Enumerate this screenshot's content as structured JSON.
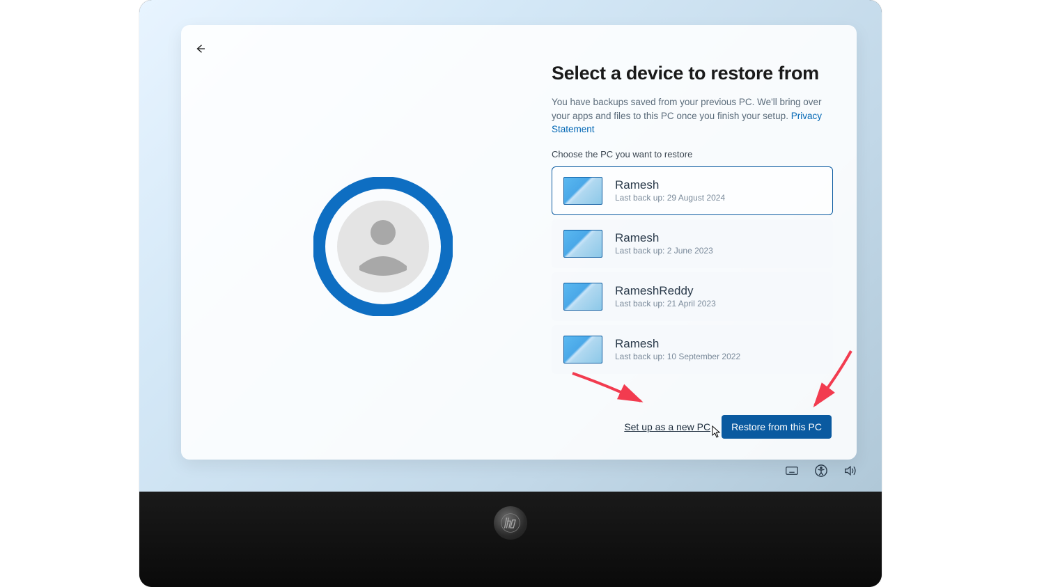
{
  "colors": {
    "accent": "#0a5aa0",
    "link": "#0066b4",
    "annotation": "#f23b4f"
  },
  "header": {
    "title": "Select a device to restore from",
    "description_prefix": "You have backups saved from your previous PC. We'll bring over your apps and files to this PC once you finish your setup.",
    "privacy_link": "Privacy Statement",
    "choose_label": "Choose the PC you want to restore"
  },
  "devices": [
    {
      "name": "Ramesh",
      "sub": "Last back up: 29 August 2024",
      "selected": true
    },
    {
      "name": "Ramesh",
      "sub": "Last back up: 2 June 2023",
      "selected": false
    },
    {
      "name": "RameshReddy",
      "sub": "Last back up: 21 April 2023",
      "selected": false
    },
    {
      "name": "Ramesh",
      "sub": "Last back up: 10 September 2022",
      "selected": false
    }
  ],
  "actions": {
    "setup_new": "Set up as a new PC",
    "restore": "Restore from this PC"
  },
  "icons": {
    "back": "back-arrow-icon",
    "hero": "user-profile-icon",
    "keyboard": "keyboard-icon",
    "accessibility": "accessibility-icon",
    "volume": "volume-icon",
    "hp": "hp-logo"
  }
}
